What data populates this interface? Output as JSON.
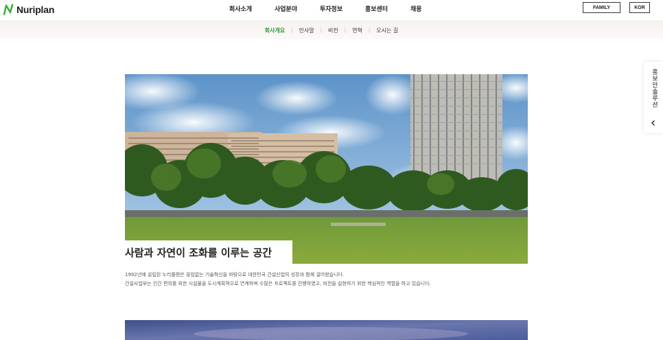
{
  "header": {
    "logo_text": "Nuriplan",
    "nav": [
      "회사소개",
      "사업분야",
      "투자정보",
      "홍보센터",
      "채용"
    ],
    "family_label": "FAMILY",
    "lang_label": "KOR"
  },
  "subnav": {
    "items": [
      "회사개요",
      "인사말",
      "비전",
      "연혁",
      "오시는 길"
    ],
    "active_index": 0
  },
  "side_tab": {
    "label": "홍보안솔루션",
    "icon": "chevron-left-icon"
  },
  "section": {
    "title": "사람과 자연이 조화를 이루는 공간",
    "description_lines": [
      "1992년에 설립된 누리플랜은 끊임없는 기술혁신을 바탕으로 대한민국 건설산업의 성장과 함께 걸어왔습니다.",
      "건설사업부는 인간 편의를 위한 시설물을 도시계획적으로 연계하며 수많은 프로젝트를 진행하였고, 비전을 실현하기 위한 핵심적인 역할을 하고 있습니다."
    ]
  },
  "colors": {
    "accent_green": "#2e9a3d",
    "subnav_bg": "#f8f3f1"
  }
}
